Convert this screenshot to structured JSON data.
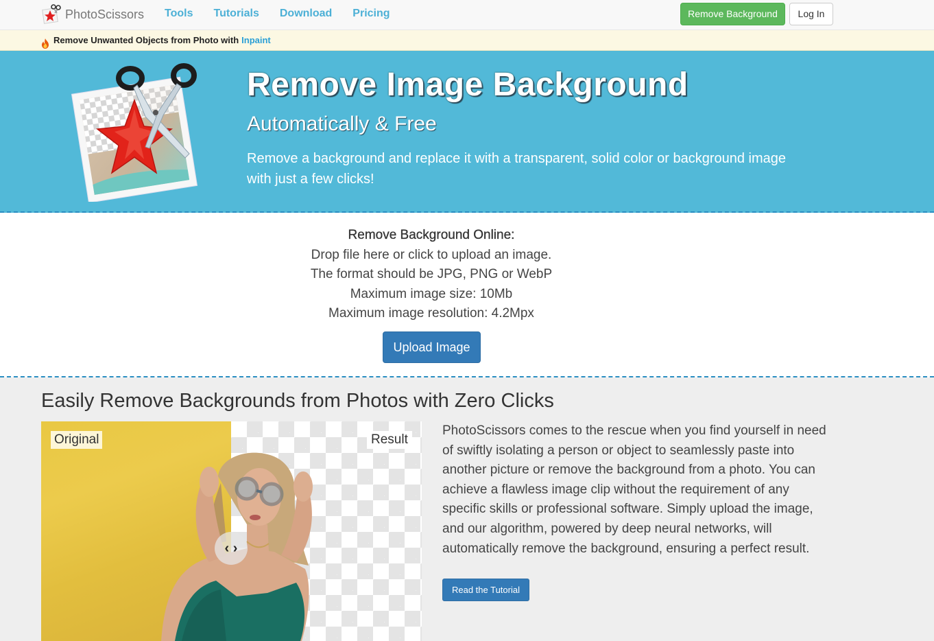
{
  "navbar": {
    "brand": "PhotoScissors",
    "links": [
      "Tools",
      "Tutorials",
      "Download",
      "Pricing"
    ],
    "remove_bg_button": "Remove Background",
    "login_button": "Log In"
  },
  "promo": {
    "text": "Remove Unwanted Objects from Photo with",
    "link": "Inpaint",
    "icon": "fire-icon"
  },
  "hero": {
    "title": "Remove Image Background",
    "subtitle": "Automatically & Free",
    "description": "Remove a background and replace it with a transparent, solid color or background image with just a few clicks!"
  },
  "upload": {
    "title": "Remove Background Online:",
    "lines": [
      "Drop file here or click to upload an image.",
      "The format should be JPG, PNG or WebP",
      "Maximum image size: 10Mb",
      "Maximum image resolution: 4.2Mpx"
    ],
    "button": "Upload Image"
  },
  "feature": {
    "title": "Easily Remove Backgrounds from Photos with Zero Clicks",
    "label_original": "Original",
    "label_result": "Result",
    "handle_glyph": "‹ ›",
    "text": "PhotoScissors comes to the rescue when you find yourself in need of swiftly isolating a person or object to seamlessly paste into another picture or remove the background from a photo. You can achieve a flawless image clip without the requirement of any specific skills or professional software. Simply upload the image, and our algorithm, powered by deep neural networks, will automatically remove the background, ensuring a perfect result.",
    "tutorial_button": "Read the Tutorial"
  },
  "colors": {
    "hero_bg": "#52b9d8",
    "nav_link": "#4cb0d6",
    "green_button": "#5cb85c",
    "blue_button": "#337ab7",
    "promo_bg": "#fcf8e3"
  }
}
